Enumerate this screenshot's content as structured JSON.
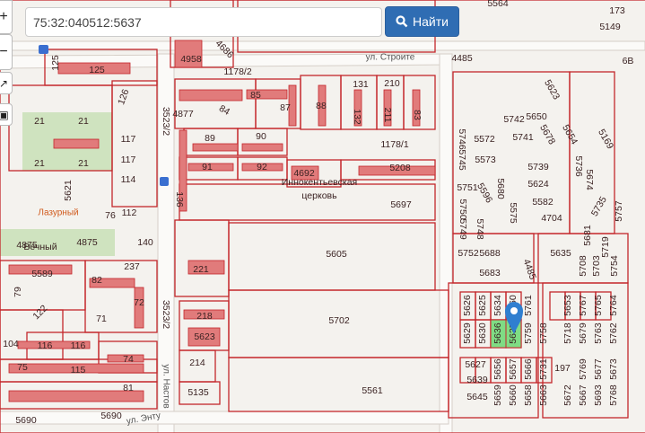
{
  "search": {
    "value": "75:32:040512:5637",
    "button_label": "Найти",
    "button_icon": "search-icon"
  },
  "controls": {
    "zoom_in": "+",
    "zoom_out": "−",
    "expand_icon": "expand-icon",
    "tool_icon": "print-icon"
  },
  "colors": {
    "parcel_border": "#c4262b",
    "building": "#e17b7b",
    "selected": "#7fdc84",
    "marker": "#2f7fd0",
    "button": "#2f6db3"
  },
  "map": {
    "selected_parcels": [
      "5636",
      "5637"
    ],
    "labels": [
      "4958",
      "4686",
      "1178/2",
      "ул. Строите",
      "4485",
      "5564",
      "173",
      "5149",
      "6В",
      "125",
      "125",
      "131",
      "210",
      "85",
      "84",
      "87",
      "88",
      "132",
      "211",
      "83",
      "4877",
      "126",
      "21",
      "21",
      "117",
      "117",
      "89",
      "90",
      "1178/1",
      "5572",
      "5742",
      "5650",
      "5741",
      "5678",
      "5623",
      "5654",
      "5169",
      "21",
      "21",
      "91",
      "92",
      "4692",
      "5208",
      "5573",
      "5746",
      "5745",
      "5739",
      "5736",
      "5621",
      "114",
      "136",
      "5697",
      "Иннокентьевская",
      "церковь",
      "5751",
      "5596",
      "5680",
      "5624",
      "5674",
      "5582",
      "5735",
      "4704",
      "5575",
      "112",
      "Лазурный",
      "76",
      "5750",
      "5749",
      "5748",
      "4875",
      "4875",
      "Вечный",
      "140",
      "5605",
      "5635",
      "5752",
      "5688",
      "5683",
      "4485",
      "5589",
      "237",
      "82",
      "79",
      "221",
      "72",
      "122",
      "71",
      "5702",
      "218",
      "5623",
      "104",
      "116",
      "116",
      "74",
      "214",
      "115",
      "75",
      "81",
      "5135",
      "5561",
      "5690",
      "5690",
      "ул. Энту",
      "3523/2",
      "3523/2",
      "ул. Настов",
      "5626",
      "5625",
      "5634",
      "5760",
      "5761",
      "5653",
      "5767",
      "5765",
      "5764",
      "5629",
      "5630",
      "5636",
      "5637",
      "5759",
      "5758",
      "5718",
      "5679",
      "5763",
      "5762",
      "5627",
      "5656",
      "5657",
      "5666",
      "5731",
      "197",
      "5769",
      "5677",
      "5673",
      "5639",
      "5645",
      "5659",
      "5660",
      "5658",
      "5663",
      "5672",
      "5667",
      "5693",
      "5768",
      "5719",
      "5708",
      "5703",
      "5754",
      "5757",
      "5681"
    ]
  }
}
